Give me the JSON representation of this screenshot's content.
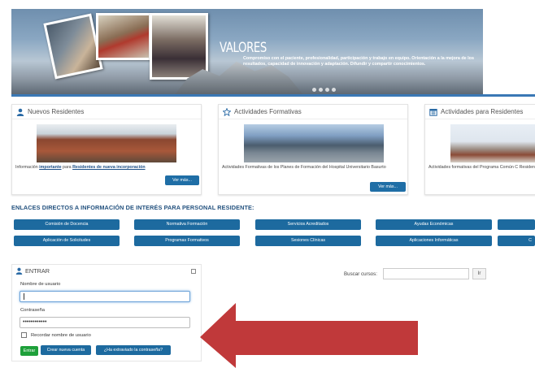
{
  "banner": {
    "title": "VALORES",
    "text": "Compromiso con el paciente, profesionalidad, participación y trabajo en equipo. Orientación a la mejora de los resultados, capacidad de innovación y adaptación. Difundir y compartir conocimientos."
  },
  "boxes": [
    {
      "title": "Nuevos Residentes",
      "icon": "user-icon",
      "desc_prefix": "Información ",
      "desc_link1": "importante",
      "desc_mid": " para ",
      "desc_link2": "Residentes de nueva incorporación",
      "button": "Ver más..."
    },
    {
      "title": "Actividades Formativas",
      "icon": "star-icon",
      "desc": "Actividades Formativas de los Planes de Formación del Hospital Universitario Basurto",
      "button": "Ver más..."
    },
    {
      "title": "Actividades para Residentes",
      "icon": "calendar-icon",
      "desc": "Actividades formativas del Programa Común C Residente"
    }
  ],
  "links": {
    "title": "ENLACES DIRECTOS A INFORMACIÓN DE INTERÉS PARA PERSONAL RESIDENTE:",
    "row1": [
      "Comisión de Docencia",
      "Normativa Formación",
      "Servicios Acreditados",
      "Ayudas Económicas",
      ""
    ],
    "row2": [
      "Aplicación de Solicitudes",
      "Programas Formativos",
      "Sesiones Clínicas",
      "Aplicaciones Informáticas",
      "C"
    ]
  },
  "login": {
    "title": "ENTRAR",
    "username_label": "Nombre de usuario",
    "username_value": "",
    "password_label": "Contraseña",
    "password_value": "••••••••••••",
    "remember_label": "Recordar nombre de usuario",
    "enter_button": "Entrar",
    "create_button": "Crear nueva cuenta",
    "forgot_button": "¿Ha extraviado la contraseña?"
  },
  "search": {
    "label": "Buscar cursos:",
    "button": "Ir"
  },
  "colors": {
    "accent_blue": "#1d6a9f",
    "heading_blue": "#24527f",
    "enter_green": "#1ea03a",
    "arrow_red": "#c0393a"
  }
}
